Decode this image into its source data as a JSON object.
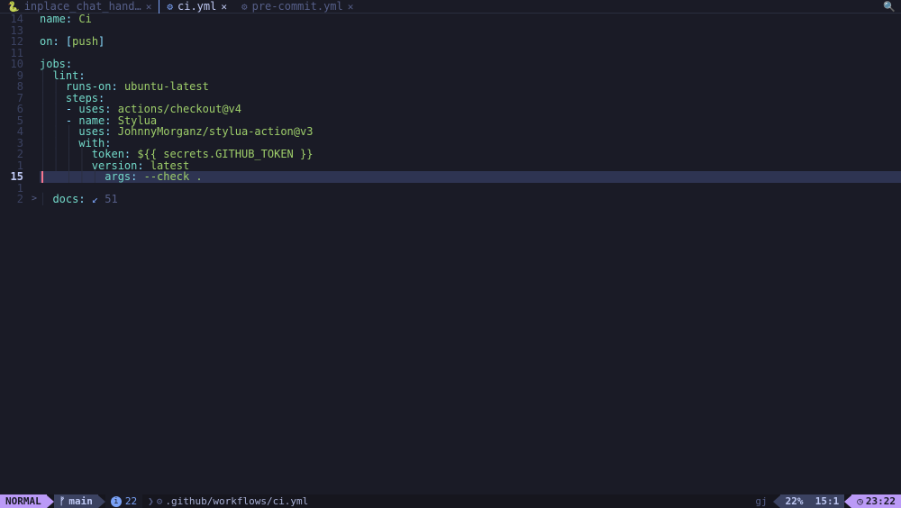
{
  "tabs": [
    {
      "icon": "🐍",
      "label": "inplace_chat_hand…",
      "active": false
    },
    {
      "icon": "⚙",
      "label": "ci.yml",
      "active": true
    },
    {
      "icon": "⚙",
      "label": "pre-commit.yml",
      "active": false
    }
  ],
  "gutter": [
    "14",
    "13",
    "12",
    "11",
    "10",
    "9",
    "8",
    "7",
    "6",
    "5",
    "4",
    "3",
    "2",
    "1",
    "15",
    "1",
    "2"
  ],
  "current_line_index": 14,
  "fold_markers": {
    "16": ">"
  },
  "code_lines": [
    {
      "segments": [
        [
          "key",
          "name"
        ],
        [
          "punct",
          ": "
        ],
        [
          "str",
          "Ci"
        ]
      ]
    },
    {
      "segments": []
    },
    {
      "segments": [
        [
          "key",
          "on"
        ],
        [
          "punct",
          ": ["
        ],
        [
          "str",
          "push"
        ],
        [
          "punct",
          "]"
        ]
      ]
    },
    {
      "segments": []
    },
    {
      "segments": [
        [
          "key",
          "jobs"
        ],
        [
          "punct",
          ":"
        ]
      ]
    },
    {
      "segments": [
        [
          "indent",
          "│ "
        ],
        [
          "key",
          "lint"
        ],
        [
          "punct",
          ":"
        ]
      ]
    },
    {
      "segments": [
        [
          "indent",
          "│ │ "
        ],
        [
          "key",
          "runs-on"
        ],
        [
          "punct",
          ": "
        ],
        [
          "str",
          "ubuntu-latest"
        ]
      ]
    },
    {
      "segments": [
        [
          "indent",
          "│ │ "
        ],
        [
          "key",
          "steps"
        ],
        [
          "punct",
          ":"
        ]
      ]
    },
    {
      "segments": [
        [
          "indent",
          "│ │ "
        ],
        [
          "punct",
          "- "
        ],
        [
          "key",
          "uses"
        ],
        [
          "punct",
          ": "
        ],
        [
          "str",
          "actions/checkout@v4"
        ]
      ]
    },
    {
      "segments": [
        [
          "indent",
          "│ │ "
        ],
        [
          "punct",
          "- "
        ],
        [
          "key",
          "name"
        ],
        [
          "punct",
          ": "
        ],
        [
          "str",
          "Stylua"
        ]
      ]
    },
    {
      "segments": [
        [
          "indent",
          "│ │ │ "
        ],
        [
          "key",
          "uses"
        ],
        [
          "punct",
          ": "
        ],
        [
          "str",
          "JohnnyMorganz/stylua-action@v3"
        ]
      ]
    },
    {
      "segments": [
        [
          "indent",
          "│ │ │ "
        ],
        [
          "key",
          "with"
        ],
        [
          "punct",
          ":"
        ]
      ]
    },
    {
      "segments": [
        [
          "indent",
          "│ │ │ │ "
        ],
        [
          "key",
          "token"
        ],
        [
          "punct",
          ": "
        ],
        [
          "str",
          "${{ secrets.GITHUB_TOKEN }}"
        ]
      ]
    },
    {
      "segments": [
        [
          "indent",
          "│ │ │ │ "
        ],
        [
          "key",
          "version"
        ],
        [
          "punct",
          ": "
        ],
        [
          "str",
          "latest"
        ]
      ]
    },
    {
      "hl": true,
      "segments": [
        [
          "indent",
          "    │ │ │ "
        ],
        [
          "key",
          "args"
        ],
        [
          "punct",
          ": "
        ],
        [
          "str",
          "--check ."
        ]
      ]
    },
    {
      "segments": []
    },
    {
      "segments": [
        [
          "indent",
          "│ "
        ],
        [
          "key",
          "docs"
        ],
        [
          "punct",
          ": "
        ],
        [
          "fold-arrow",
          "↙"
        ],
        [
          "fold-txt",
          " 51"
        ]
      ]
    }
  ],
  "status": {
    "mode": "NORMAL",
    "branch_icon": "ᚠ",
    "branch": "main",
    "diag_icon": "i",
    "diag_count": "22",
    "path_sep": "❯",
    "path_icon": "⚙",
    "path": ".github/workflows/ci.yml",
    "enc": "gj",
    "percent": "22%",
    "pos": "15:1",
    "clock_icon": "◷",
    "time": "23:22"
  }
}
